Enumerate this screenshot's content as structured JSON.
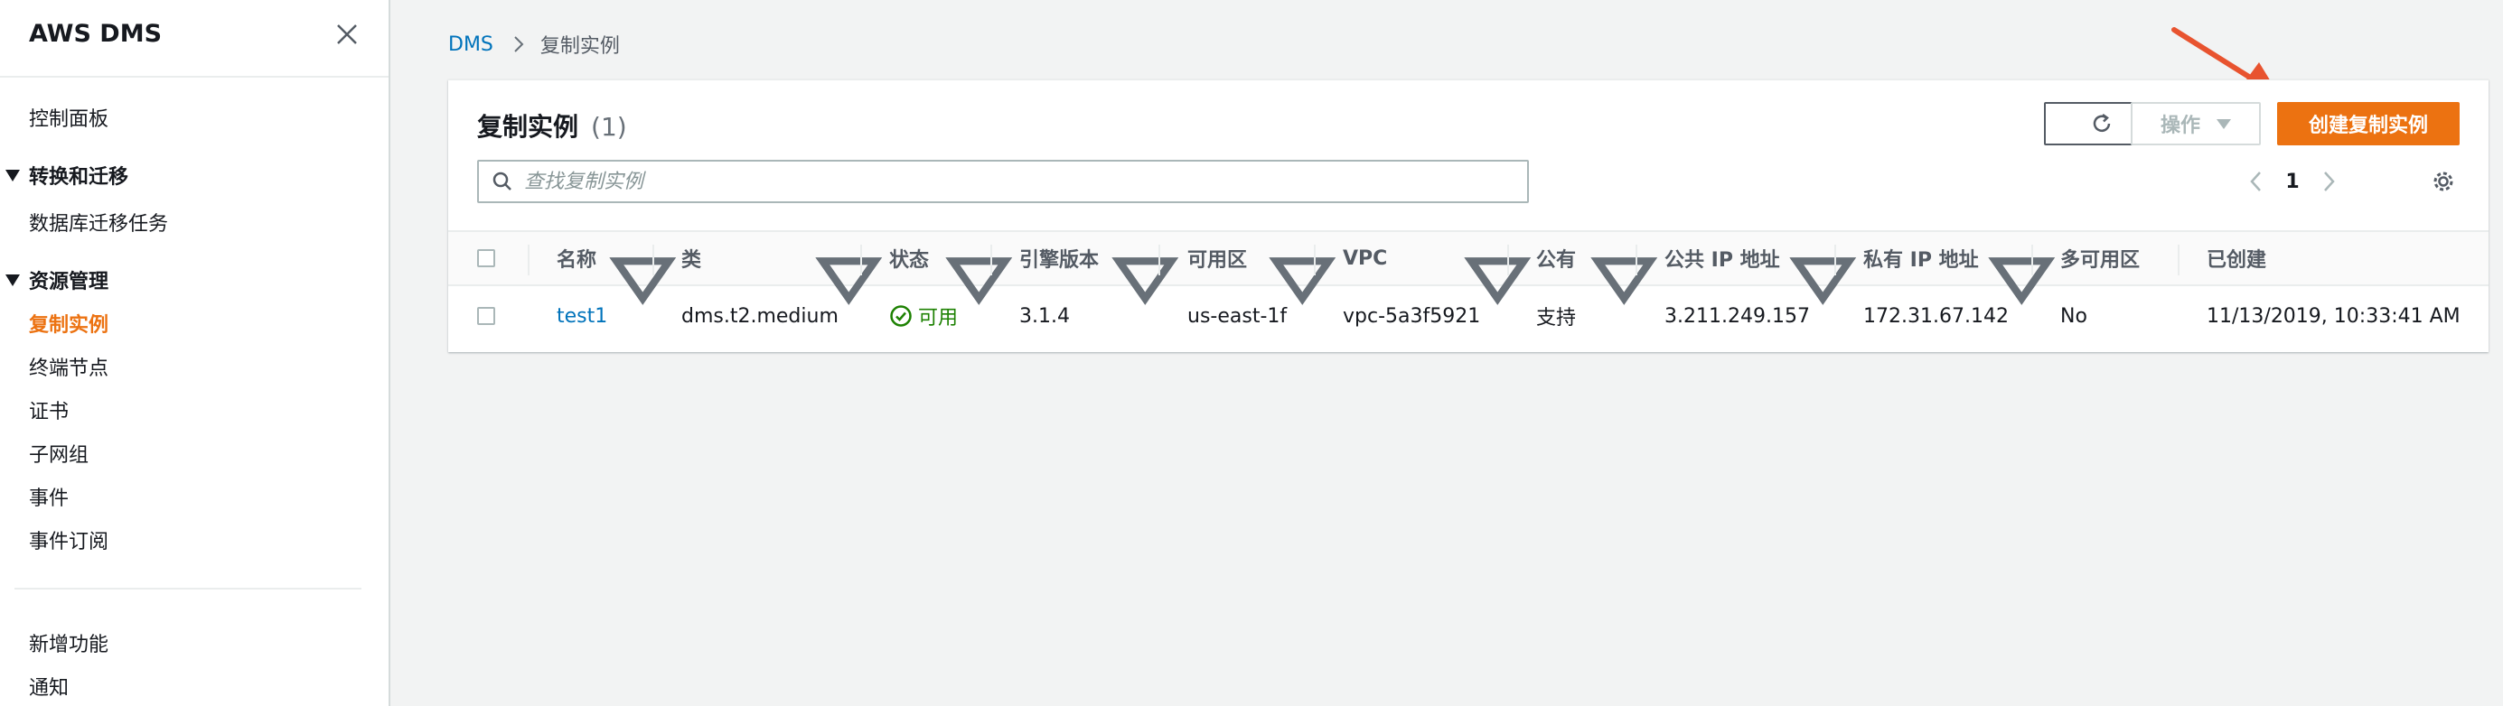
{
  "sidebar": {
    "title": "AWS DMS",
    "items_top": [
      "控制面板"
    ],
    "sections": [
      {
        "label": "转换和迁移",
        "items": [
          "数据库迁移任务"
        ]
      },
      {
        "label": "资源管理",
        "items": [
          "复制实例",
          "终端节点",
          "证书",
          "子网组",
          "事件",
          "事件订阅"
        ]
      }
    ],
    "items_bottom": [
      "新增功能",
      "通知"
    ],
    "active": "复制实例"
  },
  "breadcrumb": {
    "root": "DMS",
    "current": "复制实例"
  },
  "panel": {
    "title": "复制实例",
    "count": "(1)",
    "actions_label": "操作",
    "create_label": "创建复制实例",
    "search_placeholder": "查找复制实例",
    "page": "1"
  },
  "table": {
    "columns": [
      "名称",
      "类",
      "状态",
      "引擎版本",
      "可用区",
      "VPC",
      "公有",
      "公共 IP 地址",
      "私有 IP 地址",
      "多可用区",
      "已创建"
    ],
    "rows": [
      {
        "name": "test1",
        "class": "dms.t2.medium",
        "status": "可用",
        "engine": "3.1.4",
        "az": "us-east-1f",
        "vpc": "vpc-5a3f5921",
        "public": "支持",
        "public_ip": "3.211.249.157",
        "private_ip": "172.31.67.142",
        "multi_az": "No",
        "created": "11/13/2019, 10:33:41 AM"
      }
    ]
  },
  "colors": {
    "accent": "#ec7211",
    "link": "#0073bb",
    "success": "#1d8102",
    "annotation": "#e8532f"
  },
  "icons": [
    "close-icon",
    "chevron-right-icon",
    "refresh-icon",
    "caret-down-icon",
    "search-icon",
    "chevron-left-icon",
    "settings-gear-icon",
    "sort-caret-icon",
    "check-circle-icon",
    "annotation-arrow"
  ]
}
